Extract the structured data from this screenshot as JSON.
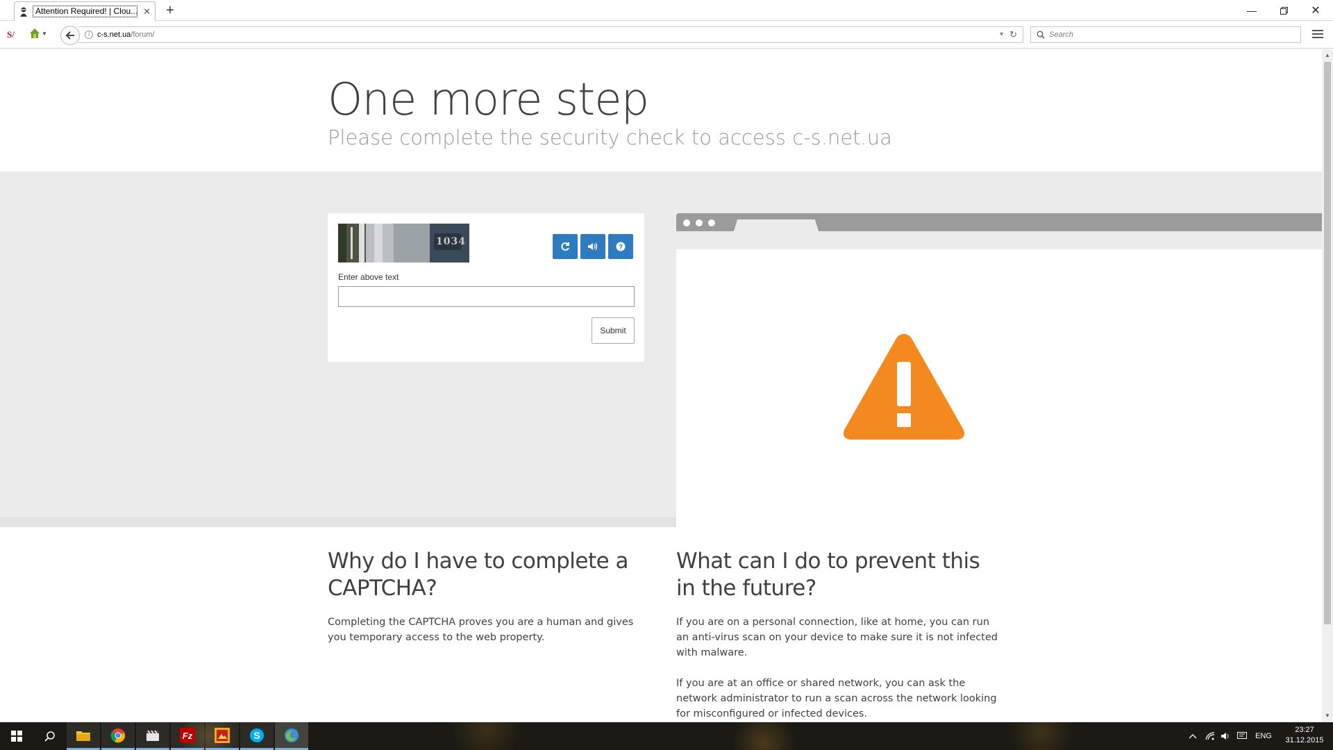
{
  "browser": {
    "tab_title": "Attention Required! | Clou...",
    "url_domain": "c-s.net.ua",
    "url_path": "/forum/",
    "search_placeholder": "Search"
  },
  "page": {
    "headline": "One more step",
    "subheadline": "Please complete the security check to access c-s.net.ua",
    "captcha": {
      "image_text": "1034",
      "label": "Enter above text",
      "submit_label": "Submit"
    },
    "section_why": {
      "heading": "Why do I have to complete a CAPTCHA?",
      "text": "Completing the CAPTCHA proves you are a human and gives you temporary access to the web property."
    },
    "section_prevent": {
      "heading": "What can I do to prevent this in the future?",
      "paragraph1": "If you are on a personal connection, like at home, you can run an anti-virus scan on your device to make sure it is not infected with malware.",
      "paragraph2": "If you are at an office or shared network, you can ask the network administrator to run a scan across the network looking for misconfigured or infected devices."
    }
  },
  "taskbar": {
    "language": "ENG",
    "time": "23:27",
    "date": "31.12.2015",
    "icons": [
      "windows-start-icon",
      "search-icon",
      "file-explorer-icon",
      "chrome-icon",
      "clapper-icon",
      "filezilla-icon",
      "image-app-icon",
      "skype-icon",
      "firefox-icon"
    ]
  },
  "colors": {
    "accent_blue": "#2f7bbf",
    "warning_orange": "#f4891f",
    "band_gray": "#ebebeb"
  }
}
